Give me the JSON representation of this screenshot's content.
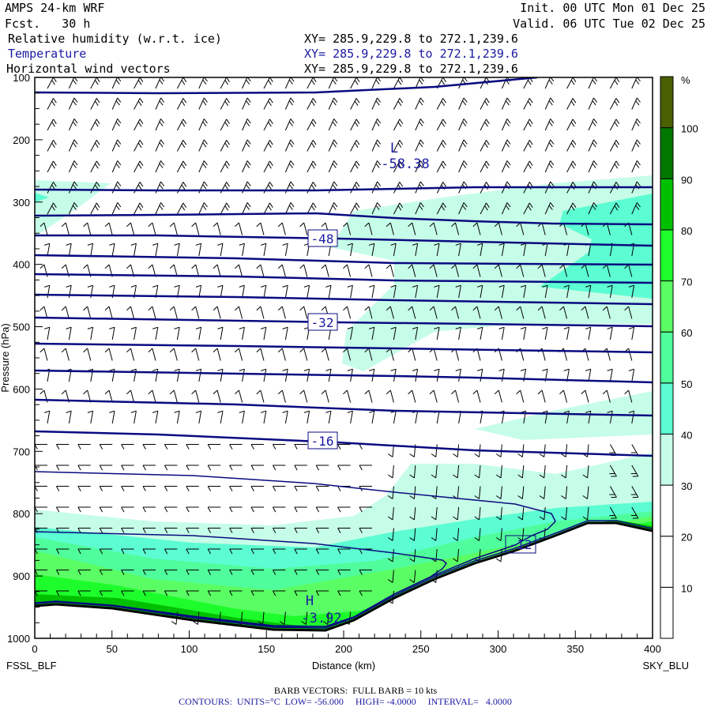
{
  "header": {
    "model": "AMPS 24-km WRF",
    "init": "Init. 00 UTC Mon 01 Dec 25",
    "fcst": "Fcst.   30 h",
    "valid": "Valid. 06 UTC Tue 02 Dec 25",
    "fields": [
      {
        "name": "Relative humidity (w.r.t. ice)",
        "xy": "XY= 285.9,229.8 to 272.1,239.6",
        "color": "#000000"
      },
      {
        "name": "Temperature",
        "xy": "XY= 285.9,229.8 to 272.1,239.6",
        "color": "#1a1aa0"
      },
      {
        "name": "Horizontal wind vectors",
        "xy": "XY= 285.9,229.8 to 272.1,239.6",
        "color": "#000000"
      }
    ]
  },
  "footer": {
    "barb_note": "BARB VECTORS:  FULL BARB = 10 kts",
    "contour_note": "CONTOURS:  UNITS=°C  LOW= -56.000     HIGH= -4.0000     INTERVAL=   4.0000"
  },
  "chart_data": {
    "type": "heatmap",
    "title": "Cross-section: RH (w.r.t. ice), Temperature, Horizontal wind",
    "xlabel": "Distance (km)",
    "ylabel": "Pressure (hPa)",
    "xlim": [
      0,
      400
    ],
    "ylim": [
      1000,
      100
    ],
    "x_ticks": [
      "0",
      "50",
      "100",
      "150",
      "200",
      "250",
      "300",
      "350",
      "400"
    ],
    "y_ticks": [
      "100",
      "200",
      "300",
      "400",
      "500",
      "600",
      "700",
      "800",
      "900",
      "1000"
    ],
    "start_label": "FSSL_BLF",
    "end_label": "SKY_BLU",
    "colorbar": {
      "unit": "%",
      "tick_labels": [
        "10",
        "20",
        "30",
        "40",
        "50",
        "60",
        "70",
        "80",
        "90",
        "100"
      ],
      "bins": [
        {
          "range": [
            0,
            10
          ],
          "color": "#ffffff"
        },
        {
          "range": [
            10,
            20
          ],
          "color": "#ffffff"
        },
        {
          "range": [
            20,
            30
          ],
          "color": "#ffffff"
        },
        {
          "range": [
            30,
            40
          ],
          "color": "#c6fde8"
        },
        {
          "range": [
            40,
            50
          ],
          "color": "#5cfdd2"
        },
        {
          "range": [
            50,
            60
          ],
          "color": "#50fd9c"
        },
        {
          "range": [
            60,
            70
          ],
          "color": "#5afd64"
        },
        {
          "range": [
            70,
            80
          ],
          "color": "#1efd2c"
        },
        {
          "range": [
            80,
            90
          ],
          "color": "#00c000"
        },
        {
          "range": [
            90,
            100
          ],
          "color": "#007800"
        },
        {
          "range": [
            100,
            110
          ],
          "color": "#4a6000"
        }
      ]
    },
    "temperature_contours": {
      "units": "°C",
      "low": -56,
      "high": -4,
      "interval": 4,
      "levels": [
        -56,
        -56,
        -52,
        -48,
        -44,
        -40,
        -36,
        -32,
        -28,
        -24,
        -20,
        -16,
        -12,
        -8,
        -4
      ],
      "labels": [
        "-48",
        "-32",
        "-16",
        "-12"
      ],
      "low_marker": {
        "letter": "L",
        "value": "-58.38"
      },
      "high_marker": {
        "letter": "H",
        "value": "-3.92"
      },
      "color": "#0a0a80"
    }
  }
}
